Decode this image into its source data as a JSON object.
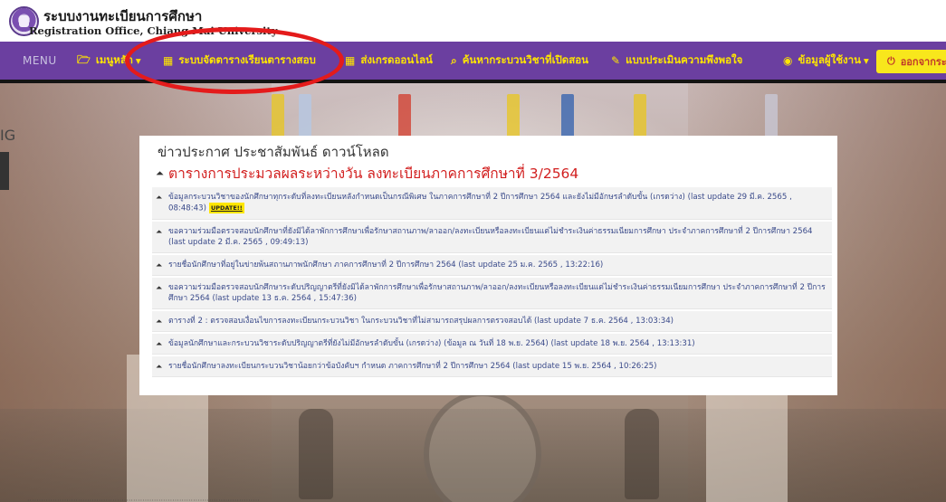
{
  "header": {
    "title": "ระบบงานทะเบียนการศึกษา",
    "subtitle": "Registration Office, Chiang Mai University"
  },
  "nav": {
    "menu": "MENU",
    "main_menu": "เมนูหลัก",
    "schedule": "ระบบจัดตารางเรียนตารางสอบ",
    "grade_online": "ส่งเกรดออนไลน์",
    "course_search": "ค้นหากระบวนวิชาที่เปิดสอน",
    "survey": "แบบประเมินความพึงพอใจ",
    "user_info": "ข้อมูลผู้ใช้งาน",
    "logout": "ออกจากระบ"
  },
  "background": {
    "left_fragment": "IG"
  },
  "panel": {
    "title": "ข่าวประกาศ ประชาสัมพันธ์ ดาวน์โหลด",
    "headline": "ตารางการประมวลผลระหว่างวัน ลงทะเบียนภาคการศึกษาที่ 3/2564",
    "update_badge": "UPDATE!!",
    "items": [
      {
        "text": "ข้อมูลกระบวนวิชาของนักศึกษาทุกระดับที่ลงทะเบียนหลังกำหนดเป็นกรณีพิเศษ ในภาคการศึกษาที่ 2 ปีการศึกษา 2564 และยังไม่มีอักษรลำดับขั้น (เกรดว่าง) (last update 29 มี.ค. 2565 , 08:48:43)"
      },
      {
        "text": "ขอความร่วมมือตรวจสอบนักศึกษาที่ยังมิได้ลาพักการศึกษาเพื่อรักษาสถานภาพ/ลาออก/ลงทะเบียนหรือลงทะเบียนแต่ไม่ชำระเงินค่าธรรมเนียมการศึกษา ประจำภาคการศึกษาที่ 2 ปีการศึกษา 2564 (last update 2 มี.ค. 2565 , 09:49:13)"
      },
      {
        "text": "รายชื่อนักศึกษาที่อยู่ในข่ายพ้นสถานภาพนักศึกษา ภาคการศึกษาที่ 2 ปีการศึกษา 2564 (last update 25 ม.ค. 2565 , 13:22:16)"
      },
      {
        "text": "ขอความร่วมมือตรวจสอบนักศึกษาระดับปริญญาตรีที่ยังมิได้ลาพักการศึกษาเพื่อรักษาสถานภาพ/ลาออก/ลงทะเบียนหรือลงทะเบียนแต่ไม่ชำระเงินค่าธรรมเนียมการศึกษา ประจำภาคการศึกษาที่ 2 ปีการศึกษา 2564 (last update 13 ธ.ค. 2564 , 15:47:36)"
      },
      {
        "text": "ตารางที่ 2 : ตรวจสอบเงื่อนไขการลงทะเบียนกระบวนวิชา ในกระบวนวิชาที่ไม่สามารถสรุปผลการตรวจสอบได้ (last update 7 ธ.ค. 2564 , 13:03:34)"
      },
      {
        "text": "ข้อมูลนักศึกษาและกระบวนวิชาระดับปริญญาตรีที่ยังไม่มีอักษรลำดับขั้น (เกรดว่าง) (ข้อมูล ณ วันที่ 18 พ.ย. 2564) (last update 18 พ.ย. 2564 , 13:13:31)"
      },
      {
        "text": "รายชื่อนักศึกษาลงทะเบียนกระบวนวิชาน้อยกว่าข้อบังคับฯ กำหนด ภาคการศึกษาที่ 2 ปีการศึกษา 2564 (last update 15 พ.ย. 2564 , 10:26:25)"
      }
    ]
  },
  "colors": {
    "navbar": "#6b3fa0",
    "nav_text": "#ffe600",
    "headline": "#d21f1f",
    "link": "#3a4a8a",
    "annotation": "#e41b1b"
  },
  "icons": {
    "menu_folder": "folder-icon",
    "calendar": "calendar-icon",
    "search": "search-icon",
    "pencil": "pencil-icon",
    "user": "user-icon",
    "power": "power-icon",
    "bell": "bell-icon"
  }
}
